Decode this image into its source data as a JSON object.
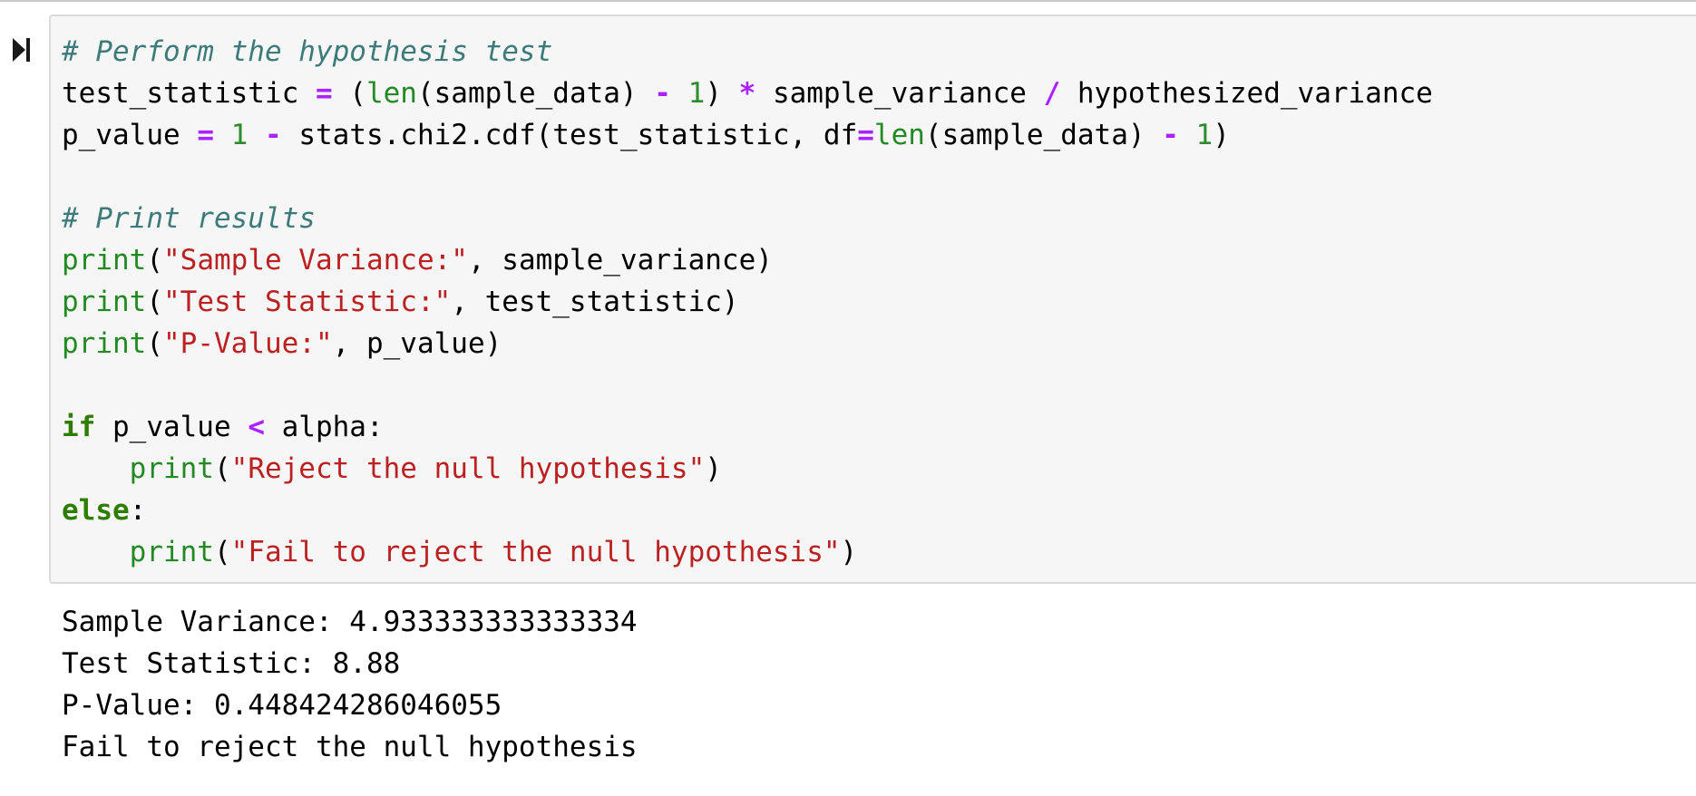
{
  "cell": {
    "run_icon": "run-cell-icon",
    "code": {
      "line1": {
        "comment": "# Perform the hypothesis test"
      },
      "line2": {
        "var": "test_statistic ",
        "eq": "=",
        "t1": " (",
        "fn": "len",
        "t2": "(sample_data) ",
        "minus": "-",
        "t3": " ",
        "one": "1",
        "t4": ") ",
        "mul": "*",
        "t5": " sample_variance ",
        "div": "/",
        "t6": " hypothesized_variance"
      },
      "line3": {
        "var": "p_value ",
        "eq": "=",
        "t1": " ",
        "one": "1",
        "t2": " ",
        "minus": "-",
        "t3": " stats.chi2.cdf(test_statistic, df",
        "eq2": "=",
        "fn": "len",
        "t4": "(sample_data) ",
        "minus2": "-",
        "t5": " ",
        "one2": "1",
        "t6": ")"
      },
      "line5": {
        "comment": "# Print results"
      },
      "line6": {
        "fn": "print",
        "open": "(",
        "str": "\"Sample Variance:\"",
        "rest": ", sample_variance)"
      },
      "line7": {
        "fn": "print",
        "open": "(",
        "str": "\"Test Statistic:\"",
        "rest": ", test_statistic)"
      },
      "line8": {
        "fn": "print",
        "open": "(",
        "str": "\"P-Value:\"",
        "rest": ", p_value)"
      },
      "line10": {
        "kw": "if",
        "t1": " p_value ",
        "lt": "<",
        "t2": " alpha:"
      },
      "line11": {
        "indent": "    ",
        "fn": "print",
        "open": "(",
        "str": "\"Reject the null hypothesis\"",
        "close": ")"
      },
      "line12": {
        "kw": "else",
        "colon": ":"
      },
      "line13": {
        "indent": "    ",
        "fn": "print",
        "open": "(",
        "str": "\"Fail to reject the null hypothesis\"",
        "close": ")"
      }
    }
  },
  "output": {
    "lines": [
      "Sample Variance: 4.933333333333334",
      "Test Statistic: 8.88",
      "P-Value: 0.448424286046055",
      "Fail to reject the null hypothesis"
    ]
  }
}
